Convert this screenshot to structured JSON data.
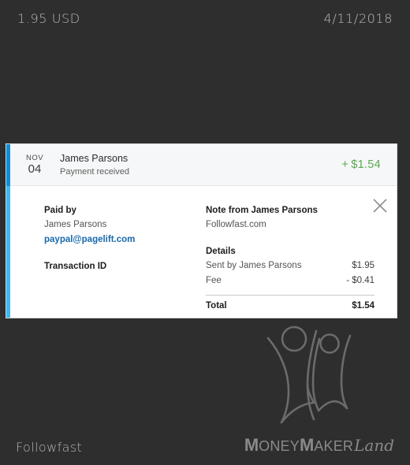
{
  "topbar": {
    "amount": "1.95 USD",
    "date": "4/11/2018"
  },
  "card": {
    "accent_color": "#3fb7ef",
    "accent_top_color": "#0f8fd4",
    "header": {
      "date_month": "NOV",
      "date_day": "04",
      "name": "James Parsons",
      "subtitle": "Payment received",
      "amount_sign": "+",
      "amount": "$1.54",
      "amount_color": "#5aab4f"
    },
    "close_icon_label": "✕",
    "paid_by": {
      "title": "Paid by",
      "name": "James Parsons",
      "email": "paypal@pagelift.com",
      "email_color": "#1769ad"
    },
    "transaction": {
      "title": "Transaction ID",
      "value": ""
    },
    "note": {
      "title": "Note from James Parsons",
      "body": "Followfast.com"
    },
    "details": {
      "title": "Details",
      "rows": [
        {
          "label": "Sent by James Parsons",
          "value": "$1.95"
        },
        {
          "label": "Fee",
          "value": "- $0.41"
        }
      ],
      "total_label": "Total",
      "total_value": "$1.54"
    }
  },
  "footer": {
    "site_label": "Followfast",
    "brand": {
      "m1": "M",
      "oney": "ONEY",
      "m2": "M",
      "aker": "AKER",
      "land": "Land"
    }
  }
}
